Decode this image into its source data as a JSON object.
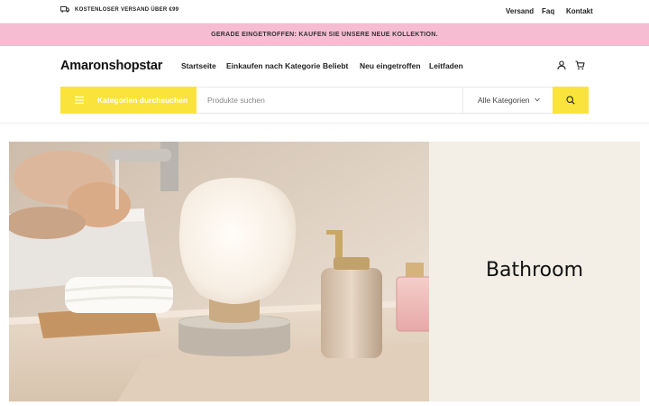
{
  "topbar": {
    "shipping_text": "KOSTENLOSER VERSAND ÜBER €99",
    "links": [
      "Versand",
      "Faq",
      "Kontakt"
    ]
  },
  "announcement": "GERADE EINGETROFFEN: KAUFEN SIE UNSERE NEUE KOLLEKTION.",
  "header": {
    "logo": "Amaronshopstar",
    "nav": [
      "Startseite",
      "Einkaufen nach Kategorie",
      "Beliebt",
      "Neu eingetroffen",
      "Leitfaden"
    ]
  },
  "search": {
    "category_button": "Kategorien durchsuchen",
    "placeholder": "Produkte suchen",
    "value": "",
    "category_select": "Alle Kategorien"
  },
  "hero": {
    "title": "Bathroom"
  },
  "colors": {
    "accent_yellow": "#fae43c",
    "announcement_pink": "#f6bcd2",
    "panel_beige": "#f3eee6"
  }
}
